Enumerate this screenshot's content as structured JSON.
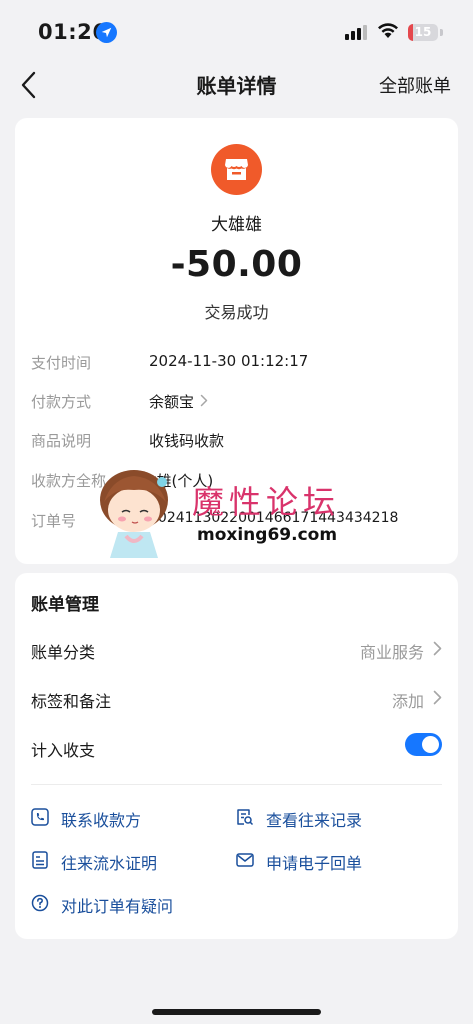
{
  "status_bar": {
    "time": "01:26",
    "battery": "15",
    "battery_level": 0.15
  },
  "nav": {
    "title": "账单详情",
    "right_link": "全部账单"
  },
  "transaction": {
    "merchant_name": "大雄雄",
    "amount": "-50.00",
    "status": "交易成功",
    "logo_color": "#f05a2a"
  },
  "details": [
    {
      "label": "支付时间",
      "value": "2024-11-30 01:12:17",
      "has_chevron": false
    },
    {
      "label": "付款方式",
      "value": "余额宝",
      "has_chevron": true
    },
    {
      "label": "商品说明",
      "value": "收钱码收款",
      "has_chevron": false
    },
    {
      "label": "收款方全称",
      "value": "*雄(个人)",
      "has_chevron": false
    },
    {
      "label": "订单号",
      "value": "20241130220014661714434342​18",
      "has_chevron": false
    }
  ],
  "watermark": {
    "text": "魔性论坛",
    "url": "moxing69.com"
  },
  "management": {
    "title": "账单管理",
    "category": {
      "label": "账单分类",
      "value": "商业服务"
    },
    "tags": {
      "label": "标签和备注",
      "value": "添加"
    },
    "include": {
      "label": "计入收支",
      "enabled": true
    }
  },
  "actions": {
    "contact": "联系收款方",
    "history": "查看往来记录",
    "proof": "往来流水证明",
    "receipt": "申请电子回单",
    "question": "对此订单有疑问"
  },
  "colors": {
    "accent": "#1677ff",
    "link": "#1a4f9c",
    "brand_orange": "#f05a2a"
  }
}
